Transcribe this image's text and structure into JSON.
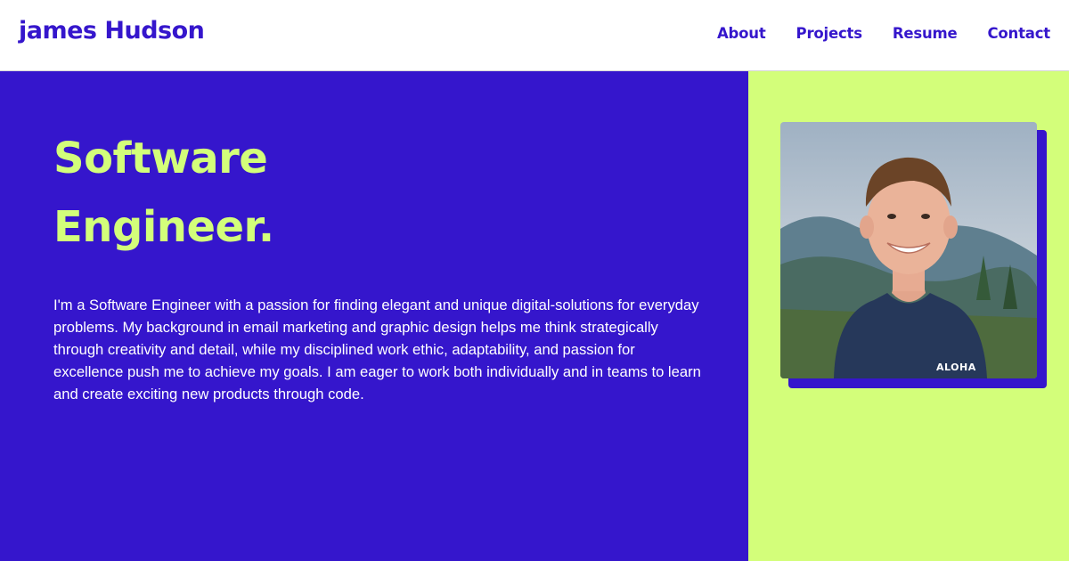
{
  "header": {
    "logo": "james Hudson",
    "nav": [
      {
        "label": "About"
      },
      {
        "label": "Projects"
      },
      {
        "label": "Resume"
      },
      {
        "label": "Contact"
      }
    ]
  },
  "hero": {
    "headline_line1": "Software",
    "headline_line2": "Engineer.",
    "bio": "I'm a Software Engineer with a passion for finding elegant and unique digital-solutions for everyday problems. My background in email marketing and graphic design helps me think strategically through creativity and detail, while my disciplined work ethic, adaptability, and passion for excellence push me to achieve my goals. I am eager to work both individually and in teams to learn and create exciting new products through code."
  },
  "profile_photo": {
    "shirt_text": "ALOHA"
  },
  "colors": {
    "brand_blue": "#3516cc",
    "accent_lime": "#d3fe7a",
    "text_white": "#ffffff"
  }
}
